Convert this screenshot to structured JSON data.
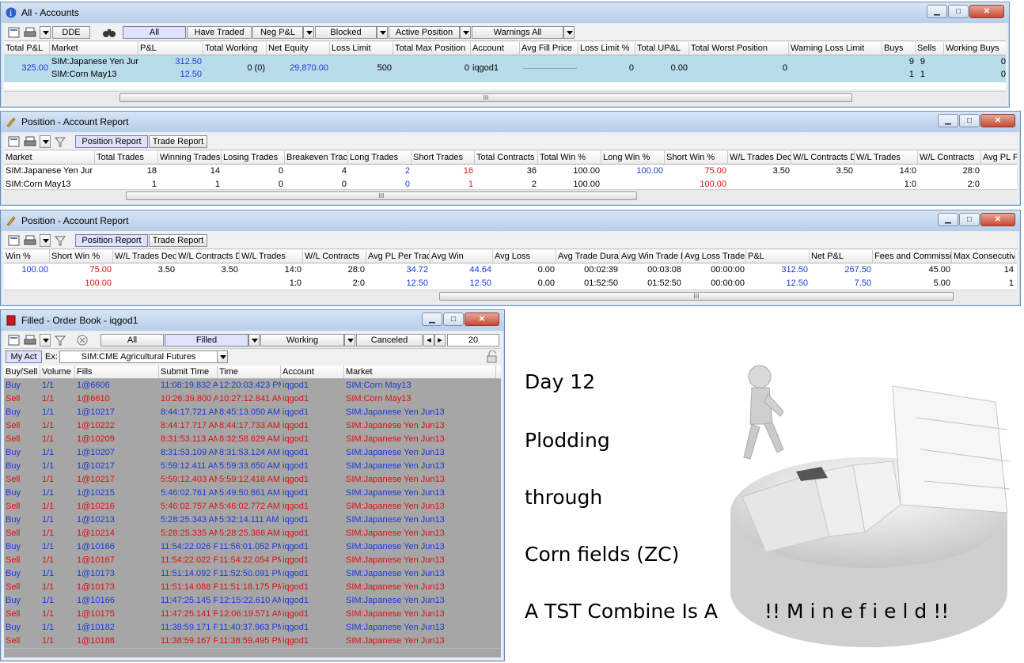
{
  "accounts": {
    "title": "All - Accounts",
    "toolbar": {
      "dde": "DDE",
      "all": "All",
      "have_traded": "Have Traded",
      "neg_pl": "Neg P&L",
      "blocked": "Blocked",
      "active_position": "Active Position",
      "warnings": "Warnings All"
    },
    "columns": [
      "Total P&L",
      "Market",
      "P&L",
      "Total Working",
      "Net Equity",
      "Loss Limit",
      "Total Max Position",
      "Account",
      "Avg Fill Price",
      "Loss Limit %",
      "Total UP&L",
      "Total Worst Position",
      "Warning Loss Limit",
      "Buys",
      "Sells",
      "Working Buys"
    ],
    "row": {
      "total_pl": "325.00",
      "market_1": "SIM:Japanese Yen Jur",
      "pl_1": "312.50",
      "market_2": "SIM:Corn May13",
      "pl_2": "12.50",
      "total_working": "0 (0)",
      "net_equity": "29,870.00",
      "loss_limit": "500",
      "total_max_position": "0",
      "account": "iqgod1",
      "loss_limit_pct": "0",
      "total_upl": "0.00",
      "total_worst_position": "0",
      "buys_1": "9",
      "sells_1": "9",
      "working_1": "0",
      "buys_2": "1",
      "sells_2": "1",
      "working_2": "0"
    },
    "scroll_grip": "III"
  },
  "report1": {
    "title": "Position - Account Report",
    "tabs": {
      "position": "Position Report",
      "trade": "Trade Report"
    },
    "columns": [
      "Market",
      "Total Trades",
      "Winning Trades",
      "Losing Trades",
      "Breakeven Trac",
      "Long Trades",
      "Short Trades",
      "Total Contracts",
      "Total Win %",
      "Long Win %",
      "Short Win %",
      "W/L Trades Dec",
      "W/L Contracts D",
      "W/L Trades",
      "W/L Contracts",
      "Avg PL Pe"
    ],
    "rows": [
      [
        "SIM:Japanese Yen Jur",
        "18",
        "14",
        "0",
        "4",
        "2",
        "16",
        "36",
        "100.00",
        "100.00",
        "75.00",
        "3.50",
        "3.50",
        "14:0",
        "28:0",
        ""
      ],
      [
        "SIM:Corn May13",
        "1",
        "1",
        "0",
        "0",
        "0",
        "1",
        "2",
        "100.00",
        "",
        "100.00",
        "",
        "",
        "1:0",
        "2:0",
        ""
      ]
    ],
    "scroll_grip": "III"
  },
  "report2": {
    "title": "Position - Account Report",
    "tabs": {
      "position": "Position Report",
      "trade": "Trade Report"
    },
    "columns": [
      "Win %",
      "Short Win %",
      "W/L Trades Dec",
      "W/L Contracts D",
      "W/L Trades",
      "W/L Contracts",
      "Avg PL Per Trac",
      "Avg Win",
      "Avg Loss",
      "Avg Trade Dura",
      "Avg Win Trade D",
      "Avg Loss Trade",
      "P&L",
      "Net P&L",
      "Fees and Commissi",
      "Max Consecutiv"
    ],
    "rows": [
      [
        "100.00",
        "75.00",
        "3.50",
        "3.50",
        "14:0",
        "28:0",
        "34.72",
        "44.64",
        "0.00",
        "00:02:39",
        "00:03:08",
        "00:00:00",
        "312.50",
        "267.50",
        "45.00",
        "14"
      ],
      [
        "",
        "100.00",
        "",
        "",
        "1:0",
        "2:0",
        "12.50",
        "12.50",
        "0.00",
        "01:52:50",
        "01:52:50",
        "00:00:00",
        "12.50",
        "7.50",
        "5.00",
        "1"
      ]
    ],
    "scroll_grip": "III"
  },
  "orderbook": {
    "title": "Filled - Order Book - iqgod1",
    "filters": {
      "all": "All",
      "filled": "Filled",
      "working": "Working",
      "canceled": "Canceled",
      "count": "20"
    },
    "my_act": "My Act",
    "ex_label": "Ex:",
    "exchange": "SIM:CME Agricultural Futures",
    "columns": [
      "Buy/Sell",
      "Volume",
      "Fills",
      "Submit Time",
      "Time",
      "Account",
      "Market"
    ],
    "rows": [
      [
        "Buy",
        "1/1",
        "1@6606",
        "11:08:19.832 A",
        "12:20:03.423 PM",
        "iqgod1",
        "SIM:Corn May13"
      ],
      [
        "Sell",
        "1/1",
        "1@6610",
        "10:26:39.800 A",
        "10:27:12.841 AM",
        "iqgod1",
        "SIM:Corn May13"
      ],
      [
        "Buy",
        "1/1",
        "1@10217",
        "8:44:17.721 AM",
        "8:45:13.050 AM",
        "iqgod1",
        "SIM:Japanese Yen Jun13"
      ],
      [
        "Sell",
        "1/1",
        "1@10222",
        "8:44:17.717 AM",
        "8:44:17.733 AM",
        "iqgod1",
        "SIM:Japanese Yen Jun13"
      ],
      [
        "Sell",
        "1/1",
        "1@10209",
        "8:31:53.113 AM",
        "8:32:58.629 AM",
        "iqgod1",
        "SIM:Japanese Yen Jun13"
      ],
      [
        "Buy",
        "1/1",
        "1@10207",
        "8:31:53.109 AM",
        "8:31:53.124 AM",
        "iqgod1",
        "SIM:Japanese Yen Jun13"
      ],
      [
        "Buy",
        "1/1",
        "1@10217",
        "5:59:12.411 AM",
        "5:59:33.650 AM",
        "iqgod1",
        "SIM:Japanese Yen Jun13"
      ],
      [
        "Sell",
        "1/1",
        "1@10217",
        "5:59:12.403 AM",
        "5:59:12.418 AM",
        "iqgod1",
        "SIM:Japanese Yen Jun13"
      ],
      [
        "Buy",
        "1/1",
        "1@10215",
        "5:46:02.761 AM",
        "5:49:50.861 AM",
        "iqgod1",
        "SIM:Japanese Yen Jun13"
      ],
      [
        "Sell",
        "1/1",
        "1@10216",
        "5:46:02.757 AM",
        "5:46:02.772 AM",
        "iqgod1",
        "SIM:Japanese Yen Jun13"
      ],
      [
        "Buy",
        "1/1",
        "1@10213",
        "5:28:25.343 AM",
        "5:32:14.111 AM",
        "iqgod1",
        "SIM:Japanese Yen Jun13"
      ],
      [
        "Sell",
        "1/1",
        "1@10214",
        "5:28:25.335 AM",
        "5:28:25.366 AM",
        "iqgod1",
        "SIM:Japanese Yen Jun13"
      ],
      [
        "Buy",
        "1/1",
        "1@10166",
        "11:54:22.026 P",
        "11:56:01.052 PM",
        "iqgod1",
        "SIM:Japanese Yen Jun13"
      ],
      [
        "Sell",
        "1/1",
        "1@10167",
        "11:54:22.022 P",
        "11:54:22.054 PM",
        "iqgod1",
        "SIM:Japanese Yen Jun13"
      ],
      [
        "Buy",
        "1/1",
        "1@10173",
        "11:51:14.092 P",
        "11:52:50.091 PM",
        "iqgod1",
        "SIM:Japanese Yen Jun13"
      ],
      [
        "Sell",
        "1/1",
        "1@10173",
        "11:51:14.088 P",
        "11:51:18.175 PM",
        "iqgod1",
        "SIM:Japanese Yen Jun13"
      ],
      [
        "Buy",
        "1/1",
        "1@10166",
        "11:47:25.145 P",
        "12:15:22.610 AM",
        "iqgod1",
        "SIM:Japanese Yen Jun13"
      ],
      [
        "Sell",
        "1/1",
        "1@10175",
        "11:47:25.141 P",
        "12:06:19.571 AM",
        "iqgod1",
        "SIM:Japanese Yen Jun13"
      ],
      [
        "Buy",
        "1/1",
        "1@10182",
        "11:38:59.171 P",
        "11:40:37.963 PM",
        "iqgod1",
        "SIM:Japanese Yen Jun13"
      ],
      [
        "Sell",
        "1/1",
        "1@10188",
        "11:38:59.167 P",
        "11:38:59.495 PM",
        "iqgod1",
        "SIM:Japanese Yen Jun13"
      ]
    ]
  },
  "slide": {
    "line1": "Day 12",
    "line2": "Plodding",
    "line3": "through",
    "line4": "Corn fields (ZC)",
    "line5": "A TST Combine Is A",
    "line6": "!! M i n e f i e l d !!"
  },
  "colors": {
    "buy": "#1a3ad8",
    "sell": "#e01010",
    "selected_row": "#b8dcea",
    "filled_row": "#a6a6a6"
  }
}
